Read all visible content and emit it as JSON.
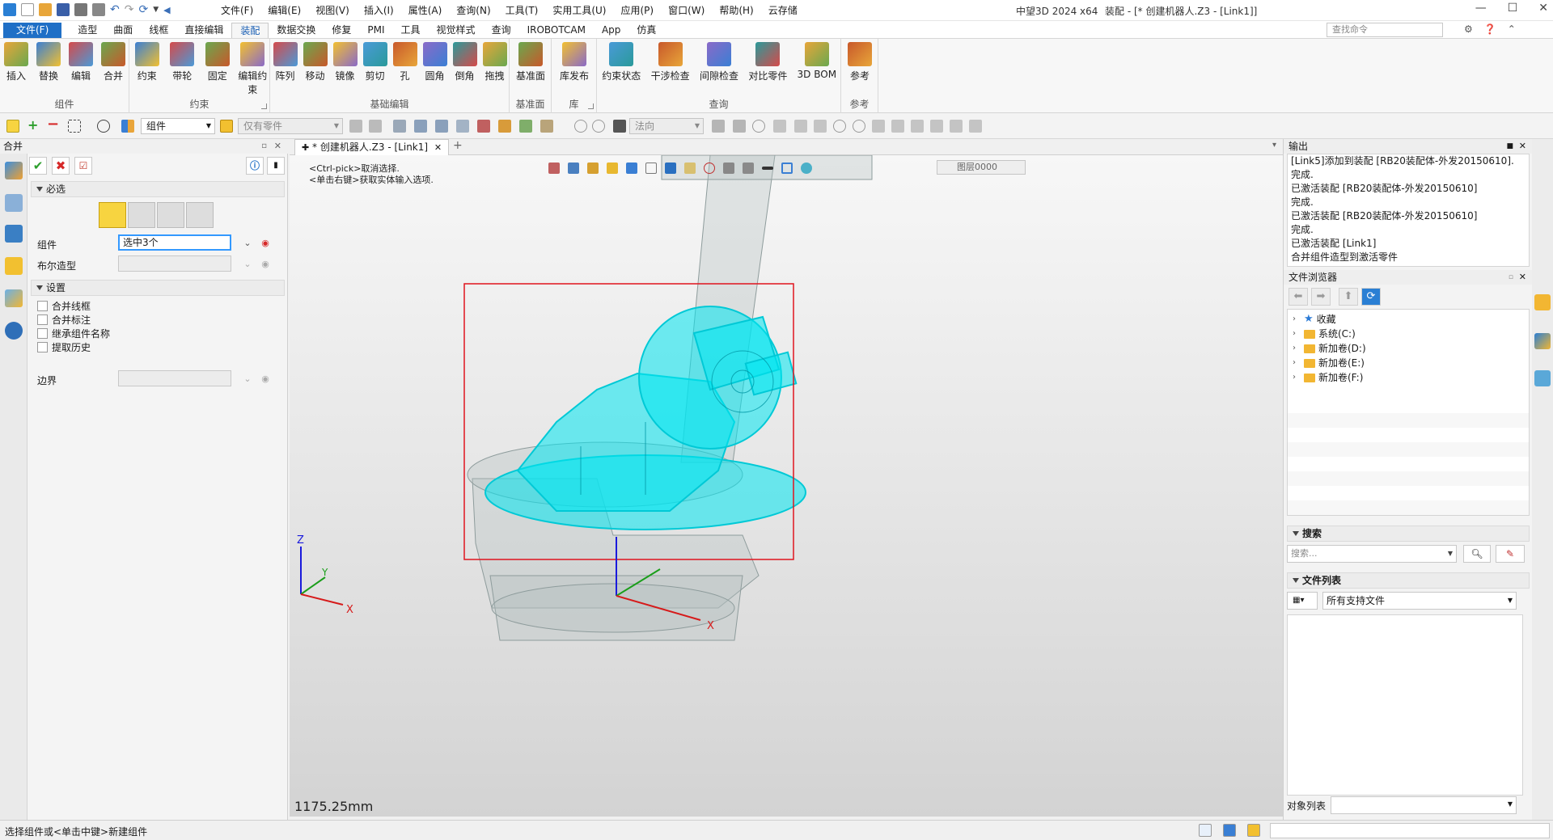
{
  "titlebar": {
    "menus": [
      "文件(F)",
      "编辑(E)",
      "视图(V)",
      "插入(I)",
      "属性(A)",
      "查询(N)",
      "工具(T)",
      "实用工具(U)",
      "应用(P)",
      "窗口(W)",
      "帮助(H)",
      "云存储"
    ],
    "app_title": "中望3D 2024 x64",
    "doc_title": "装配 - [* 创建机器人.Z3 - [Link1]]"
  },
  "ribbon_tabs": [
    "文件(F)",
    "造型",
    "曲面",
    "线框",
    "直接编辑",
    "装配",
    "数据交换",
    "修复",
    "PMI",
    "工具",
    "视觉样式",
    "查询",
    "IROBOTCAM",
    "App",
    "仿真"
  ],
  "ribbon_active_tab": "装配",
  "command_search_placeholder": "查找命令",
  "ribbon": {
    "groups": [
      {
        "label": "组件",
        "buttons": [
          "插入",
          "替换",
          "编辑",
          "合并"
        ]
      },
      {
        "label": "约束",
        "buttons": [
          "约束",
          "带轮",
          "固定",
          "编辑约束"
        ]
      },
      {
        "label": "基础编辑",
        "buttons": [
          "阵列",
          "移动",
          "镜像",
          "剪切",
          "孔",
          "圆角",
          "倒角",
          "拖拽"
        ]
      },
      {
        "label": "基准面",
        "buttons": [
          "基准面"
        ]
      },
      {
        "label": "库",
        "buttons": [
          "库发布"
        ]
      },
      {
        "label": "查询",
        "buttons": [
          "约束状态",
          "干涉检查",
          "间隙检查",
          "对比零件",
          "3D BOM"
        ]
      },
      {
        "label": "参考",
        "buttons": [
          "参考"
        ]
      }
    ]
  },
  "toolbar": {
    "filter_value": "组件",
    "scope_value": "仅有零件",
    "direction_value": "法向"
  },
  "left_panel": {
    "title": "合并",
    "section_required": "必选",
    "field_component_label": "组件",
    "field_component_value": "选中3个",
    "field_boolean_label": "布尔造型",
    "section_settings": "设置",
    "checkboxes": [
      "合并线框",
      "合并标注",
      "继承组件名称",
      "提取历史"
    ],
    "field_boundary_label": "边界"
  },
  "doc_tab": {
    "label": "* 创建机器人.Z3 - [Link1]"
  },
  "viewport": {
    "hint_lines": [
      "<Ctrl-pick>取消选择.",
      "<单击右键>获取实体输入选项."
    ],
    "layer": "图层0000",
    "scale": "1175.25mm",
    "axes": {
      "x": "X",
      "y": "Y",
      "z": "Z"
    }
  },
  "right_panel": {
    "output_title": "输出",
    "output_lines": [
      "[Link5]添加到装配 [RB20装配体-外发20150610].",
      "完成.",
      "已激活装配 [RB20装配体-外发20150610]",
      "完成.",
      "已激活装配 [RB20装配体-外发20150610]",
      "完成.",
      "已激活装配 [Link1]",
      "合并组件造型到激活零件"
    ],
    "file_browser_title": "文件浏览器",
    "tree": [
      {
        "label": "收藏",
        "icon": "star-icon"
      },
      {
        "label": "系统(C:)",
        "icon": "folder-icon"
      },
      {
        "label": "新加卷(D:)",
        "icon": "folder-icon"
      },
      {
        "label": "新加卷(E:)",
        "icon": "folder-icon"
      },
      {
        "label": "新加卷(F:)",
        "icon": "folder-icon"
      }
    ],
    "search_title": "搜索",
    "search_placeholder": "搜索...",
    "file_list_title": "文件列表",
    "file_filter": "所有支持文件",
    "object_list_label": "对象列表"
  },
  "statusbar": {
    "text": "选择组件或<单击中键>新建组件"
  },
  "colors": {
    "accent": "#1f6fc6",
    "highlight": "#00e5f0",
    "selection_box": "#e0141e"
  }
}
